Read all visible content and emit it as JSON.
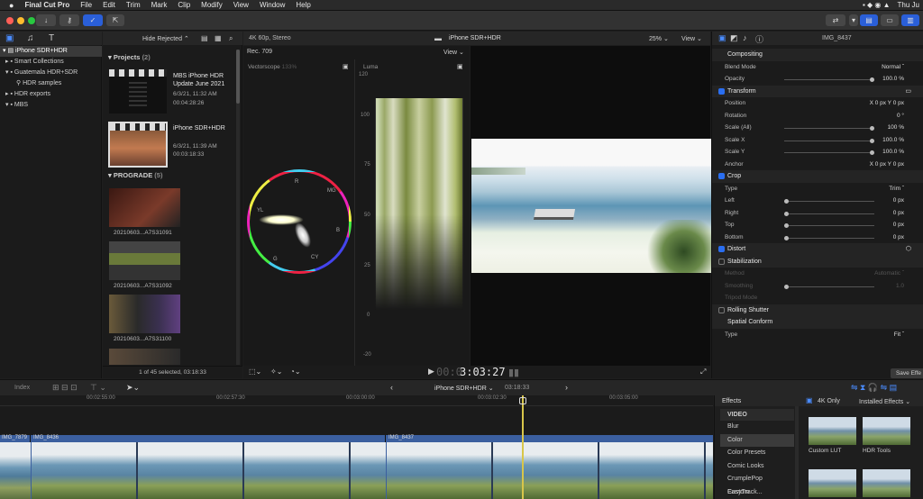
{
  "menubar": {
    "app": "Final Cut Pro",
    "items": [
      "File",
      "Edit",
      "Trim",
      "Mark",
      "Clip",
      "Modify",
      "View",
      "Window",
      "Help"
    ],
    "clock": "Thu Ju"
  },
  "browser": {
    "filter": "Hide Rejected",
    "footer": "1 of 45 selected, 03:18:33",
    "sections": {
      "projects": {
        "title": "Projects",
        "count": "(2)"
      },
      "prograde": {
        "title": "PROGRADE",
        "count": "(5)"
      }
    },
    "projects": [
      {
        "name": "MBS iPhone HDR Update June 2021",
        "date": "6/3/21, 11:32 AM",
        "duration": "00:04:28:26"
      },
      {
        "name": "iPhone SDR+HDR",
        "date": "6/3/21, 11:39 AM",
        "duration": "00:03:18:33"
      }
    ],
    "clips": [
      "20210603...A7S31091",
      "20210603...A7S31092",
      "20210603...A7S31100",
      ""
    ]
  },
  "library": {
    "items": [
      {
        "label": "iPhone SDR+HDR",
        "indent": 0
      },
      {
        "label": "Smart Collections",
        "indent": 1
      },
      {
        "label": "Guatemala HDR+SDR",
        "indent": 1
      },
      {
        "label": "HDR samples",
        "indent": 2
      },
      {
        "label": "HDR exports",
        "indent": 1
      },
      {
        "label": "MBS",
        "indent": 1
      }
    ]
  },
  "viewer": {
    "format": "4K 60p, Stereo",
    "title": "iPhone SDR+HDR",
    "zoom": "25%",
    "view": "View",
    "scope_title": "Rec. 709",
    "scope_view": "View",
    "vectorscope": "Vectorscope",
    "vectorscope_pct": "133%",
    "luma": "Luma",
    "luma_ticks": [
      "120",
      "100",
      "75",
      "50",
      "25",
      "0",
      "-20"
    ],
    "timecode": "3:03:27",
    "timecode_dim": "00:0",
    "vs_labels": [
      "R",
      "MG",
      "B",
      "CY",
      "G",
      "YL"
    ]
  },
  "inspector": {
    "clip_name": "IMG_8437",
    "rows": [
      {
        "type": "section",
        "label": "Compositing"
      },
      {
        "type": "row",
        "label": "Blend Mode",
        "value": "Normal ˆ"
      },
      {
        "type": "row",
        "label": "Opacity",
        "value": "100.0 %"
      },
      {
        "type": "section",
        "label": "Transform",
        "check": true
      },
      {
        "type": "row",
        "label": "Position",
        "value": "X     0  px   Y      0  px"
      },
      {
        "type": "row",
        "label": "Rotation",
        "value": "0 °"
      },
      {
        "type": "row",
        "label": "Scale (All)",
        "value": "100 %"
      },
      {
        "type": "row",
        "label": "Scale X",
        "value": "100.0 %"
      },
      {
        "type": "row",
        "label": "Scale Y",
        "value": "100.0 %"
      },
      {
        "type": "row",
        "label": "Anchor",
        "value": "X     0  px   Y      0  px"
      },
      {
        "type": "section",
        "label": "Crop",
        "check": true
      },
      {
        "type": "row",
        "label": "Type",
        "value": "Trim ˆ"
      },
      {
        "type": "row",
        "label": "Left",
        "value": "0 px"
      },
      {
        "type": "row",
        "label": "Right",
        "value": "0 px"
      },
      {
        "type": "row",
        "label": "Top",
        "value": "0 px"
      },
      {
        "type": "row",
        "label": "Bottom",
        "value": "0 px"
      },
      {
        "type": "section",
        "label": "Distort",
        "check": true
      },
      {
        "type": "section",
        "label": "Stabilization",
        "check": false
      },
      {
        "type": "row",
        "label": "Method",
        "value": "Automatic ˆ",
        "dim": true
      },
      {
        "type": "row",
        "label": "Smoothing",
        "value": "1.0",
        "dim": true
      },
      {
        "type": "row",
        "label": "Tripod Mode",
        "value": "",
        "dim": true
      },
      {
        "type": "section",
        "label": "Rolling Shutter",
        "check": false
      },
      {
        "type": "section",
        "label": "Spatial Conform"
      },
      {
        "type": "row",
        "label": "Type",
        "value": "Fit ˆ"
      }
    ],
    "save_effects": "Save Effe"
  },
  "timeline": {
    "index": "Index",
    "project": "iPhone SDR+HDR",
    "duration": "03:18:33",
    "ruler": [
      "00:02:55:00",
      "00:02:57:30",
      "00:03:00:00",
      "00:03:02:30",
      "00:03:05:00"
    ],
    "clips": [
      "IMG_7879",
      "IMG_8436",
      "IMG_8437"
    ]
  },
  "effects": {
    "title": "Effects",
    "filter_4k": "4K Only",
    "installed": "Installed Effects",
    "category": "VIDEO",
    "items": [
      "Blur",
      "Color",
      "Color Presets",
      "Comic Looks",
      "CrumplePop EasyTrack...",
      "Custom"
    ],
    "selected": "Color",
    "thumbs": [
      "Custom LUT",
      "HDR Tools"
    ]
  }
}
